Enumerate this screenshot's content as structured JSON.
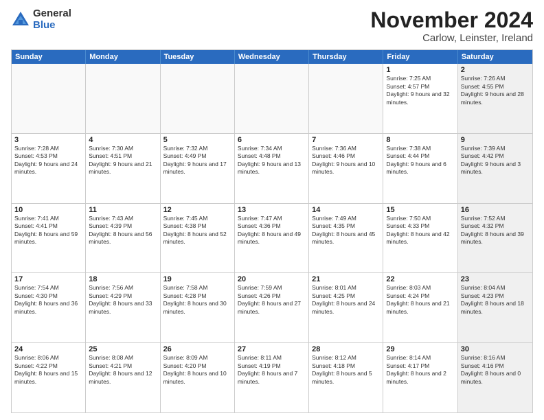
{
  "logo": {
    "general": "General",
    "blue": "Blue"
  },
  "header": {
    "month": "November 2024",
    "location": "Carlow, Leinster, Ireland"
  },
  "weekdays": [
    "Sunday",
    "Monday",
    "Tuesday",
    "Wednesday",
    "Thursday",
    "Friday",
    "Saturday"
  ],
  "rows": [
    [
      {
        "day": "",
        "text": "",
        "empty": true
      },
      {
        "day": "",
        "text": "",
        "empty": true
      },
      {
        "day": "",
        "text": "",
        "empty": true
      },
      {
        "day": "",
        "text": "",
        "empty": true
      },
      {
        "day": "",
        "text": "",
        "empty": true
      },
      {
        "day": "1",
        "text": "Sunrise: 7:25 AM\nSunset: 4:57 PM\nDaylight: 9 hours and 32 minutes.",
        "empty": false
      },
      {
        "day": "2",
        "text": "Sunrise: 7:26 AM\nSunset: 4:55 PM\nDaylight: 9 hours and 28 minutes.",
        "empty": false,
        "shaded": true
      }
    ],
    [
      {
        "day": "3",
        "text": "Sunrise: 7:28 AM\nSunset: 4:53 PM\nDaylight: 9 hours and 24 minutes.",
        "empty": false
      },
      {
        "day": "4",
        "text": "Sunrise: 7:30 AM\nSunset: 4:51 PM\nDaylight: 9 hours and 21 minutes.",
        "empty": false
      },
      {
        "day": "5",
        "text": "Sunrise: 7:32 AM\nSunset: 4:49 PM\nDaylight: 9 hours and 17 minutes.",
        "empty": false
      },
      {
        "day": "6",
        "text": "Sunrise: 7:34 AM\nSunset: 4:48 PM\nDaylight: 9 hours and 13 minutes.",
        "empty": false
      },
      {
        "day": "7",
        "text": "Sunrise: 7:36 AM\nSunset: 4:46 PM\nDaylight: 9 hours and 10 minutes.",
        "empty": false
      },
      {
        "day": "8",
        "text": "Sunrise: 7:38 AM\nSunset: 4:44 PM\nDaylight: 9 hours and 6 minutes.",
        "empty": false
      },
      {
        "day": "9",
        "text": "Sunrise: 7:39 AM\nSunset: 4:42 PM\nDaylight: 9 hours and 3 minutes.",
        "empty": false,
        "shaded": true
      }
    ],
    [
      {
        "day": "10",
        "text": "Sunrise: 7:41 AM\nSunset: 4:41 PM\nDaylight: 8 hours and 59 minutes.",
        "empty": false
      },
      {
        "day": "11",
        "text": "Sunrise: 7:43 AM\nSunset: 4:39 PM\nDaylight: 8 hours and 56 minutes.",
        "empty": false
      },
      {
        "day": "12",
        "text": "Sunrise: 7:45 AM\nSunset: 4:38 PM\nDaylight: 8 hours and 52 minutes.",
        "empty": false
      },
      {
        "day": "13",
        "text": "Sunrise: 7:47 AM\nSunset: 4:36 PM\nDaylight: 8 hours and 49 minutes.",
        "empty": false
      },
      {
        "day": "14",
        "text": "Sunrise: 7:49 AM\nSunset: 4:35 PM\nDaylight: 8 hours and 45 minutes.",
        "empty": false
      },
      {
        "day": "15",
        "text": "Sunrise: 7:50 AM\nSunset: 4:33 PM\nDaylight: 8 hours and 42 minutes.",
        "empty": false
      },
      {
        "day": "16",
        "text": "Sunrise: 7:52 AM\nSunset: 4:32 PM\nDaylight: 8 hours and 39 minutes.",
        "empty": false,
        "shaded": true
      }
    ],
    [
      {
        "day": "17",
        "text": "Sunrise: 7:54 AM\nSunset: 4:30 PM\nDaylight: 8 hours and 36 minutes.",
        "empty": false
      },
      {
        "day": "18",
        "text": "Sunrise: 7:56 AM\nSunset: 4:29 PM\nDaylight: 8 hours and 33 minutes.",
        "empty": false
      },
      {
        "day": "19",
        "text": "Sunrise: 7:58 AM\nSunset: 4:28 PM\nDaylight: 8 hours and 30 minutes.",
        "empty": false
      },
      {
        "day": "20",
        "text": "Sunrise: 7:59 AM\nSunset: 4:26 PM\nDaylight: 8 hours and 27 minutes.",
        "empty": false
      },
      {
        "day": "21",
        "text": "Sunrise: 8:01 AM\nSunset: 4:25 PM\nDaylight: 8 hours and 24 minutes.",
        "empty": false
      },
      {
        "day": "22",
        "text": "Sunrise: 8:03 AM\nSunset: 4:24 PM\nDaylight: 8 hours and 21 minutes.",
        "empty": false
      },
      {
        "day": "23",
        "text": "Sunrise: 8:04 AM\nSunset: 4:23 PM\nDaylight: 8 hours and 18 minutes.",
        "empty": false,
        "shaded": true
      }
    ],
    [
      {
        "day": "24",
        "text": "Sunrise: 8:06 AM\nSunset: 4:22 PM\nDaylight: 8 hours and 15 minutes.",
        "empty": false
      },
      {
        "day": "25",
        "text": "Sunrise: 8:08 AM\nSunset: 4:21 PM\nDaylight: 8 hours and 12 minutes.",
        "empty": false
      },
      {
        "day": "26",
        "text": "Sunrise: 8:09 AM\nSunset: 4:20 PM\nDaylight: 8 hours and 10 minutes.",
        "empty": false
      },
      {
        "day": "27",
        "text": "Sunrise: 8:11 AM\nSunset: 4:19 PM\nDaylight: 8 hours and 7 minutes.",
        "empty": false
      },
      {
        "day": "28",
        "text": "Sunrise: 8:12 AM\nSunset: 4:18 PM\nDaylight: 8 hours and 5 minutes.",
        "empty": false
      },
      {
        "day": "29",
        "text": "Sunrise: 8:14 AM\nSunset: 4:17 PM\nDaylight: 8 hours and 2 minutes.",
        "empty": false
      },
      {
        "day": "30",
        "text": "Sunrise: 8:16 AM\nSunset: 4:16 PM\nDaylight: 8 hours and 0 minutes.",
        "empty": false,
        "shaded": true
      }
    ]
  ]
}
